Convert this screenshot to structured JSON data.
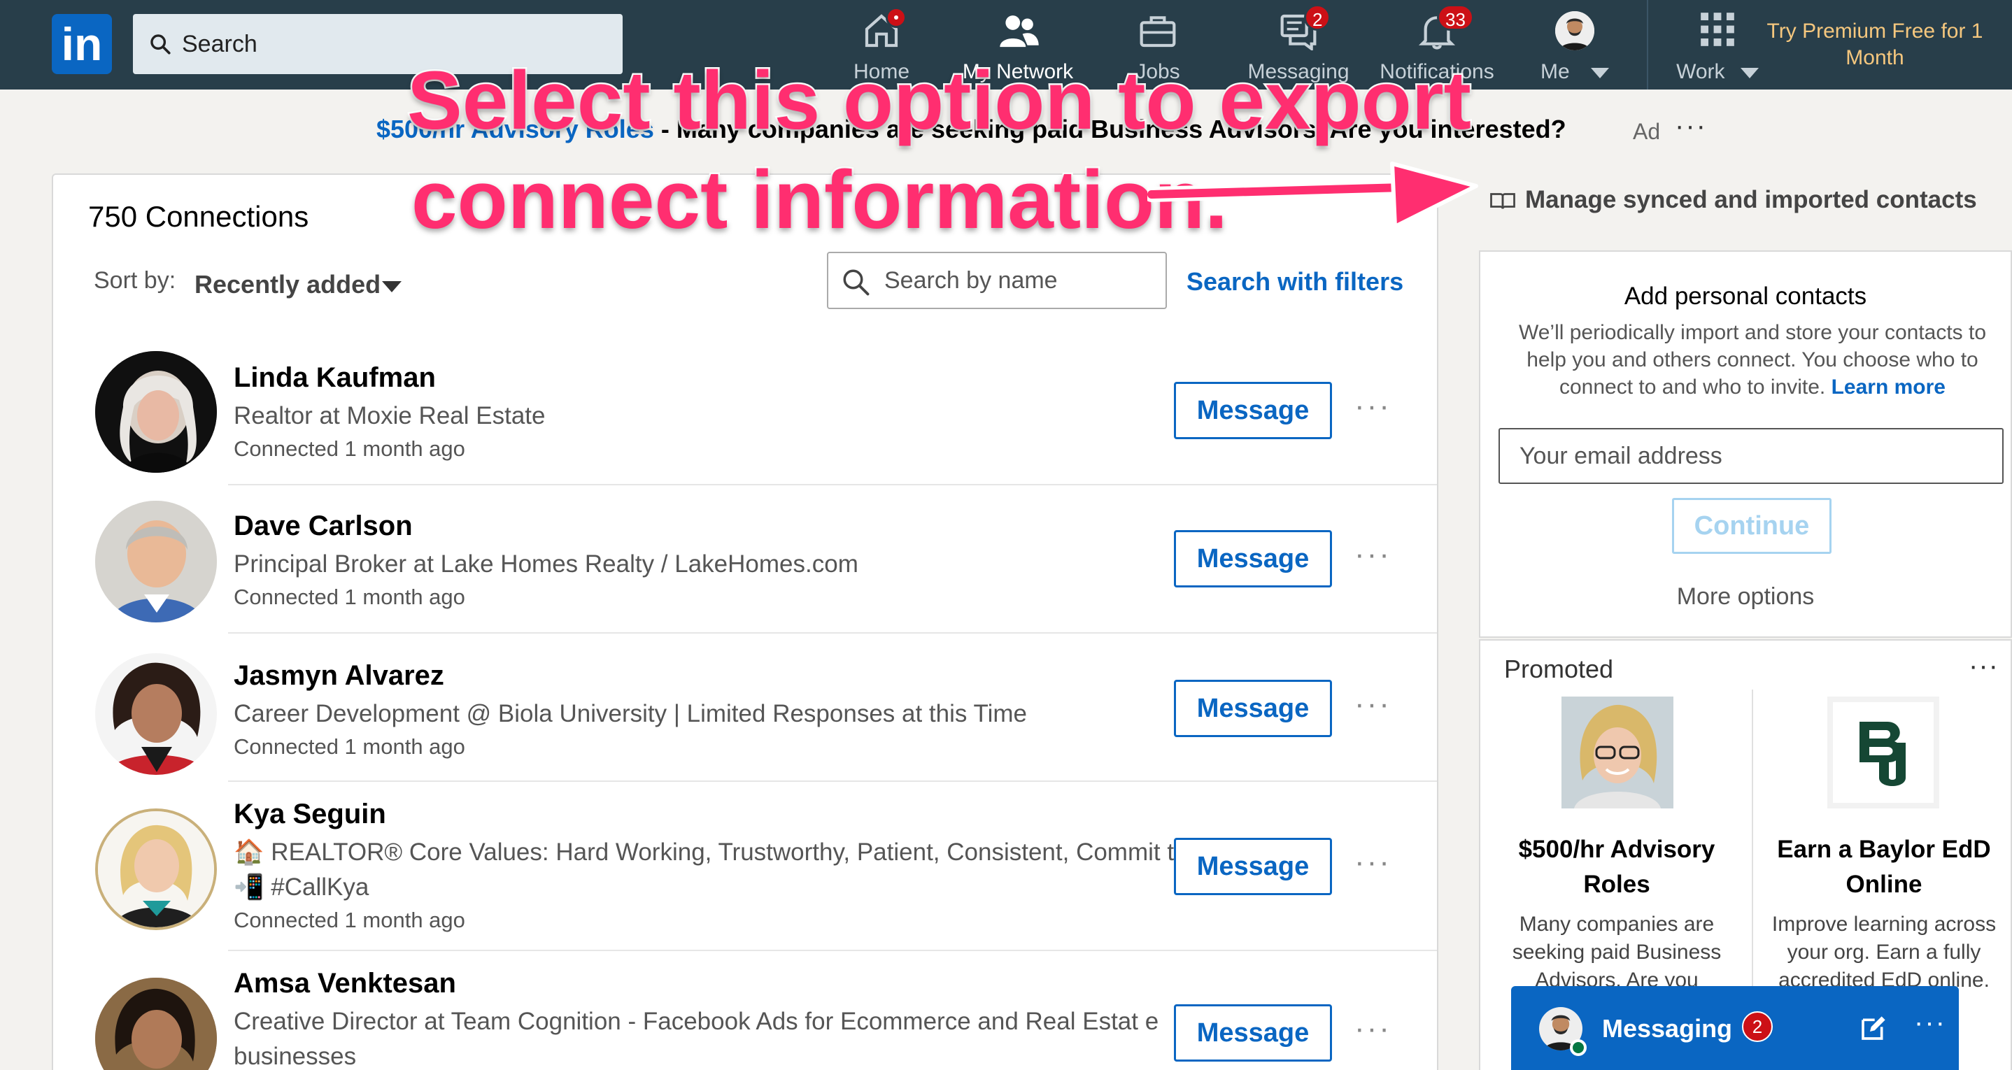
{
  "nav": {
    "logo_text": "in",
    "search_placeholder": "Search",
    "items": [
      {
        "label": "Home",
        "icon": "home-icon"
      },
      {
        "label": "My Network",
        "icon": "network-icon"
      },
      {
        "label": "Jobs",
        "icon": "briefcase-icon"
      },
      {
        "label": "Messaging",
        "icon": "messaging-icon",
        "badge": "2"
      },
      {
        "label": "Notifications",
        "icon": "bell-icon",
        "badge": "33"
      },
      {
        "label": "Me",
        "icon": "avatar"
      },
      {
        "label": "Work",
        "icon": "grid-icon"
      }
    ],
    "premium": "Try Premium Free for 1 Month",
    "colors": {
      "bar": "#283e4a",
      "badge": "#cc1016",
      "premium": "#f5c77e"
    }
  },
  "ad": {
    "link": "$500/hr Advisory Roles",
    "separator": " - ",
    "text": "Many companies are seeking paid Business Advisors. Are you interested?",
    "tag": "Ad",
    "more": "···"
  },
  "connections": {
    "count_label": "750 Connections",
    "sort_label": "Sort by:",
    "sort_value": "Recently added",
    "search_placeholder": "Search by name",
    "search_filters": "Search with filters",
    "message_label": "Message",
    "more": "···",
    "people": [
      {
        "name": "Linda Kaufman",
        "headline": "Realtor at Moxie Real Estate",
        "connected": "Connected 1 month ago"
      },
      {
        "name": "Dave Carlson",
        "headline": "Principal Broker at Lake Homes Realty / LakeHomes.com",
        "connected": "Connected 1 month ago"
      },
      {
        "name": "Jasmyn Alvarez",
        "headline": "Career Development @ Biola University | Limited Responses at this Time",
        "connected": "Connected 1 month ago"
      },
      {
        "name": "Kya Seguin",
        "headline": "🏠 REALTOR® Core Values: Hard Working, Trustworthy, Patient, Consistent, Commit ted📲 #CallKya",
        "connected": "Connected 1 month ago"
      },
      {
        "name": "Amsa Venktesan",
        "headline": "Creative Director at Team Cognition - Facebook Ads for Ecommerce and Real Estat e businesses",
        "connected": ""
      }
    ]
  },
  "sidebar": {
    "manage_link": "Manage synced and imported contacts",
    "add_title": "Add personal contacts",
    "add_desc": "We’ll periodically import and store your contacts to help you and others connect. You choose who to connect to and who to invite.",
    "learn_more": "Learn more",
    "email_placeholder": "Your email address",
    "continue": "Continue",
    "more_options": "More options",
    "promoted_label": "Promoted",
    "promoted_more": "···",
    "promos": [
      {
        "title": "$500/hr Advisory Roles",
        "desc": "Many companies are seeking paid Business Advisors. Are you"
      },
      {
        "title": "Earn a Baylor EdD Online",
        "desc": "Improve learning across your org. Earn a fully accredited EdD online."
      }
    ]
  },
  "messaging_bar": {
    "label": "Messaging",
    "badge": "2",
    "more": "···"
  },
  "annotation": {
    "line1": "Select this option to export",
    "line2": "connect information.",
    "color": "#ff2e70"
  }
}
